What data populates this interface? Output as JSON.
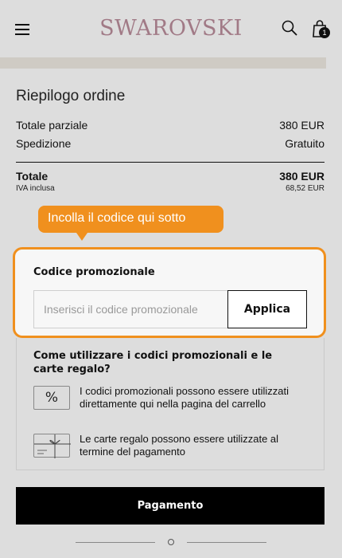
{
  "header": {
    "brand": "SWAROVSKI",
    "menu_icon": "hamburger-menu-icon",
    "search_icon": "search-icon",
    "bag_icon": "shopping-bag-icon",
    "bag_count": "1",
    "brand_color": "#a17a86"
  },
  "summary": {
    "title": "Riepilogo ordine",
    "subtotal_label": "Totale parziale",
    "subtotal_value": "380 EUR",
    "shipping_label": "Spedizione",
    "shipping_value": "Gratuito",
    "total_label": "Totale",
    "total_value": "380 EUR",
    "vat_label": "IVA inclusa",
    "vat_value": "68,52 EUR"
  },
  "tooltip": {
    "text": "Incolla il codice qui sotto",
    "color": "#f0901e"
  },
  "promo": {
    "label": "Codice promozionale",
    "placeholder": "Inserisci il codice promozionale",
    "value": "",
    "apply_label": "Applica"
  },
  "info": {
    "title": "Come utilizzare i codici promozionali e le carte regalo?",
    "items": [
      {
        "icon": "percent-icon",
        "symbol": "%",
        "text": "I codici promozionali possono essere utilizzati direttamente qui nella pagina del carrello"
      },
      {
        "icon": "gift-card-icon",
        "text": "Le carte regalo possono essere utilizzate al termine del pagamento"
      }
    ]
  },
  "checkout": {
    "pay_label": "Pagamento"
  }
}
